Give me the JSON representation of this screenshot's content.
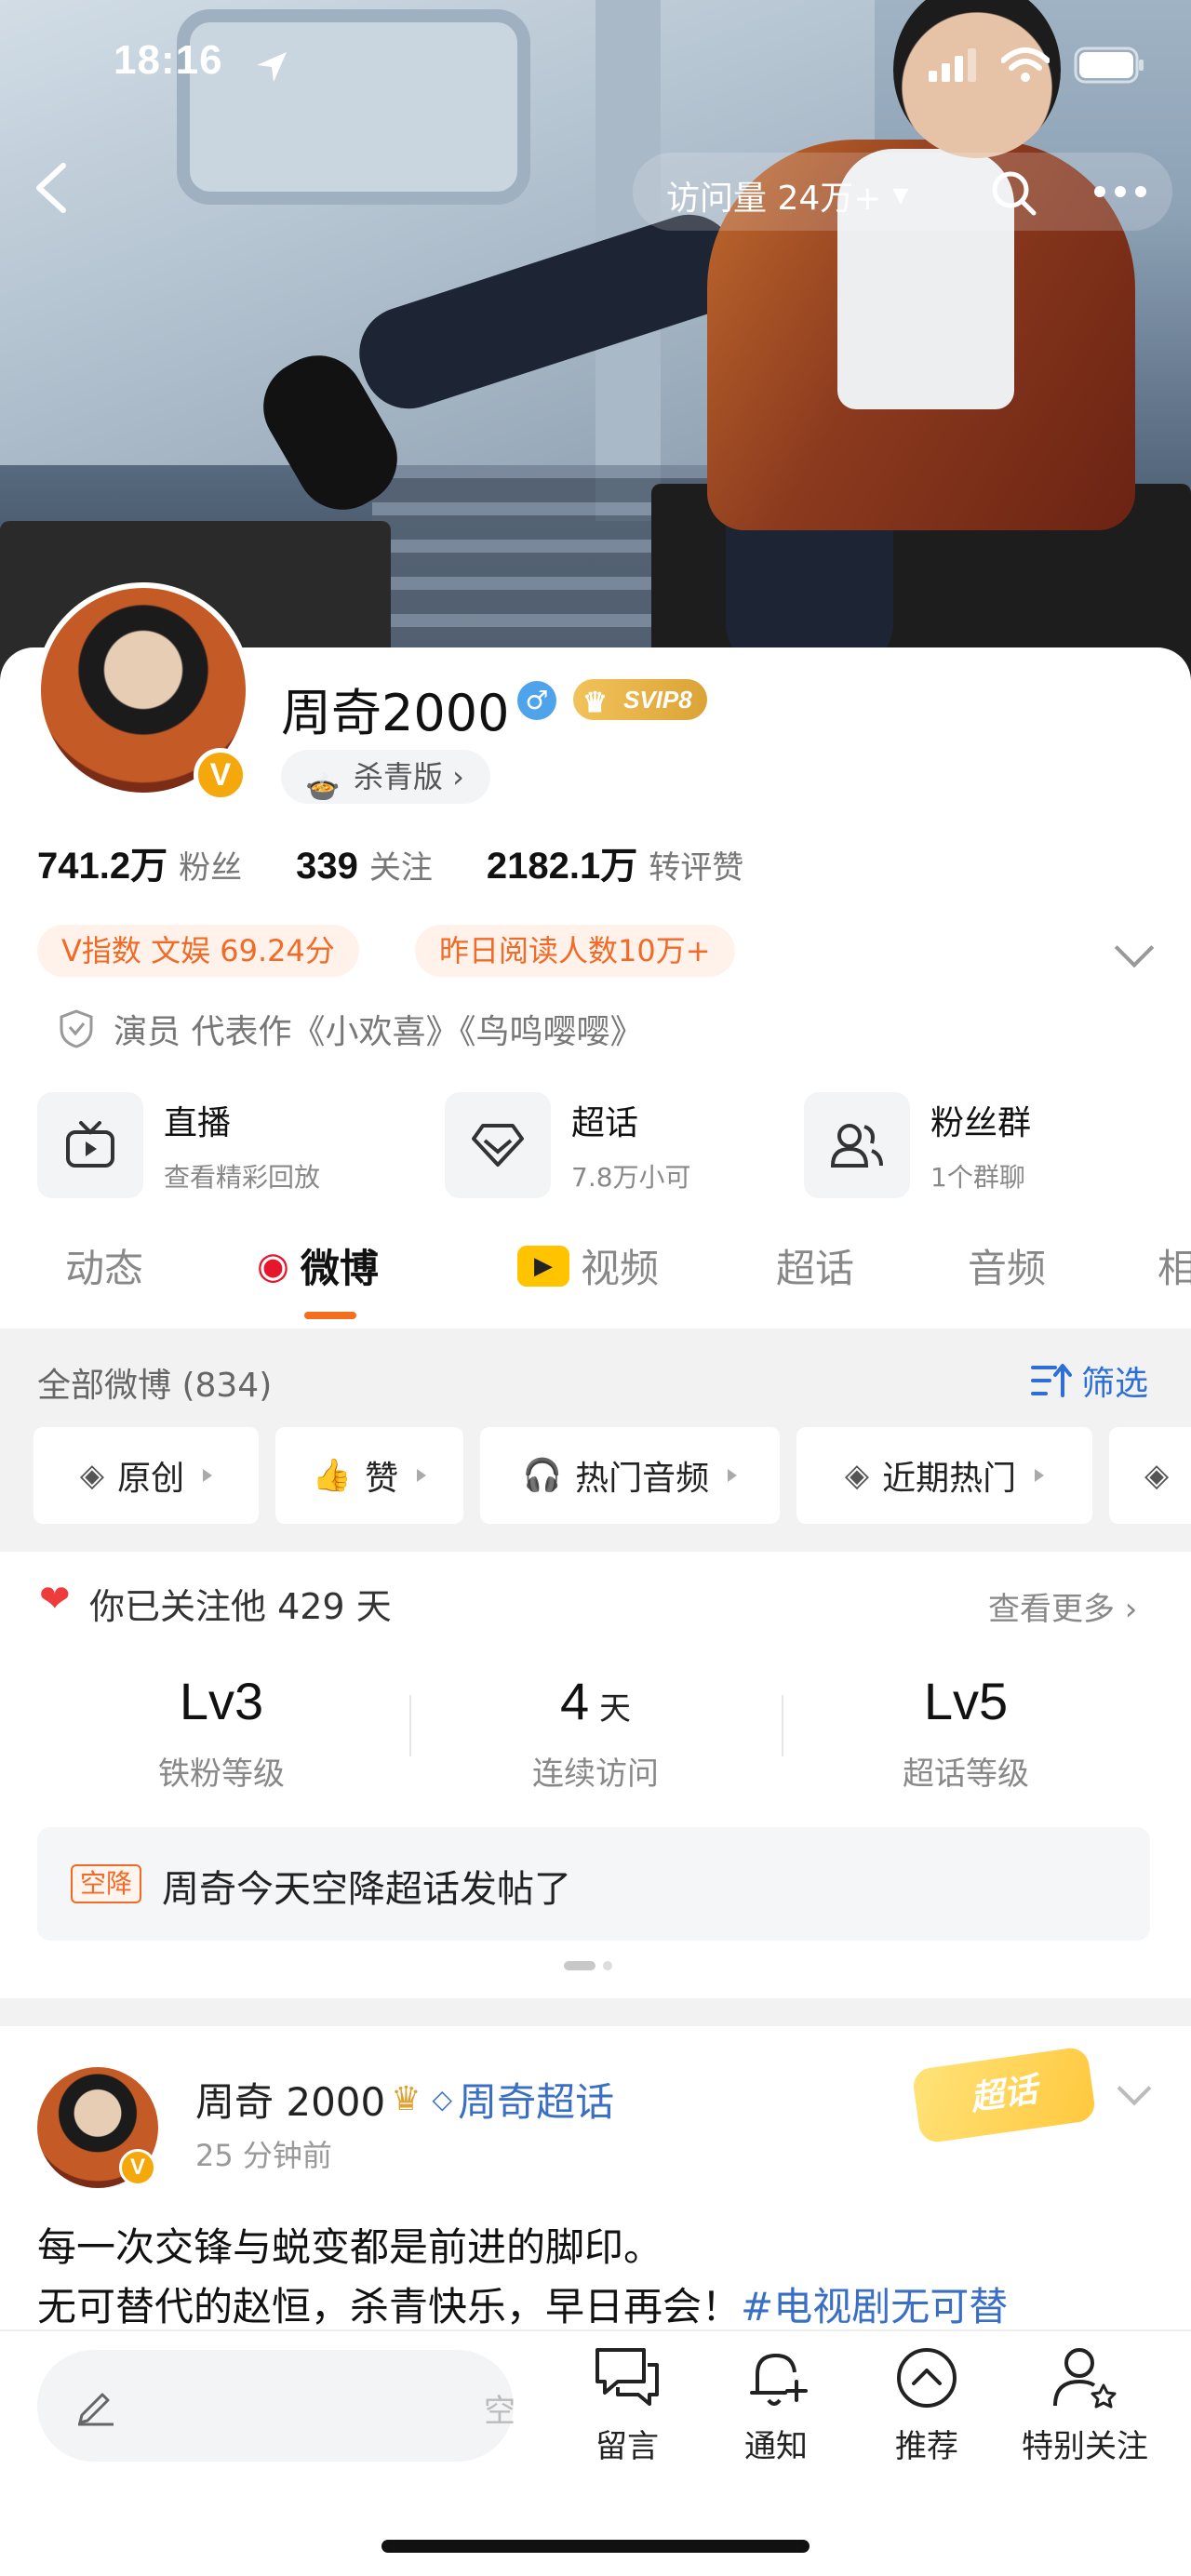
{
  "status_bar": {
    "time": "18:16"
  },
  "header": {
    "visits_label": "访问量 24万+"
  },
  "profile": {
    "name": "周奇2000",
    "gender_symbol": "♂",
    "vip_label": "SVIP8",
    "badge_v": "V",
    "wrap_tag": "杀青版 ›",
    "stats": [
      {
        "value": "741.2万",
        "label": "粉丝"
      },
      {
        "value": "339",
        "label": "关注"
      },
      {
        "value": "2182.1万",
        "label": "转评赞"
      }
    ],
    "index_tags": [
      "V指数 文娱 69.24分",
      "昨日阅读人数10万+"
    ],
    "role": "演员 代表作《小欢喜》《鸟鸣嘤嘤》",
    "features": [
      {
        "title": "直播",
        "sub": "查看精彩回放",
        "icon": "tv-icon"
      },
      {
        "title": "超话",
        "sub": "7.8万小可",
        "icon": "diamond-icon"
      },
      {
        "title": "粉丝群",
        "sub": "1个群聊",
        "icon": "group-icon"
      }
    ]
  },
  "tabs": [
    "动态",
    "微博",
    "视频",
    "超话",
    "音频",
    "相"
  ],
  "active_tab": "微博",
  "filter": {
    "count_label": "全部微博 (834)",
    "filter_label": "筛选",
    "chips": [
      "原创",
      "赞",
      "热门音频",
      "近期热门"
    ]
  },
  "follow": {
    "text": "你已关注他 429 天",
    "see_more": "查看更多 ›",
    "levels": [
      {
        "value": "Lv3",
        "unit": "",
        "label": "铁粉等级"
      },
      {
        "value": "4",
        "unit": " 天",
        "label": "连续访问"
      },
      {
        "value": "Lv5",
        "unit": "",
        "label": "超话等级"
      }
    ],
    "airdrop_tag": "空降",
    "airdrop_text": "周奇今天空降超话发帖了"
  },
  "post": {
    "author": "周奇 2000",
    "supertopic": "周奇超话",
    "time": "25 分钟前",
    "badge": "超话",
    "line1": "每一次交锋与蜕变都是前进的脚印。",
    "line2": "无可替代的赵恒，杀青快乐，早日再会！",
    "hashtag": "#电视剧无可替"
  },
  "bottom_bar": {
    "comment_tail": "空",
    "buttons": [
      "留言",
      "通知",
      "推荐",
      "特别关注"
    ]
  },
  "colors": {
    "accent": "#f46e1f",
    "link": "#2d6fd6",
    "vip_gold": "#dba336"
  }
}
